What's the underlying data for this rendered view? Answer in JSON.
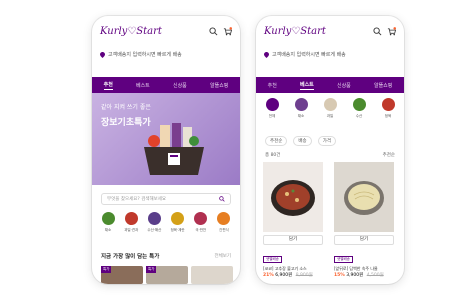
{
  "brand": {
    "logo": "Kurly♡Start",
    "accent": "#5f0080",
    "sale_color": "#fa622f"
  },
  "phone1": {
    "address": "고객배송지 입력하시면 빠르게 배송",
    "tabs": [
      "추천",
      "베스트",
      "신상품",
      "알뜰쇼핑"
    ],
    "active_tab": 0,
    "banner": {
      "subtitle": "같아 지켜 쓰기 좋은",
      "title": "장보기초특가"
    },
    "search_placeholder": "무엇을 찾으세요? 검색해보세요",
    "categories": [
      {
        "label": "채소",
        "color": "#4b8b2e"
      },
      {
        "label": "과일·견과",
        "color": "#c0392b"
      },
      {
        "label": "수산·해산",
        "color": "#5a3e8a"
      },
      {
        "label": "정육·계란",
        "color": "#d4a017"
      },
      {
        "label": "국·반찬",
        "color": "#b03050"
      },
      {
        "label": "간편식",
        "color": "#e67e22"
      }
    ],
    "section": {
      "title": "지금 가장 많이 담는 특가",
      "more": "전체보기"
    },
    "thumbs": [
      {
        "tag": "특가",
        "color": "#8a6d5a"
      },
      {
        "tag": "특가",
        "color": "#b5a99b"
      },
      {
        "tag": "",
        "color": "#ddd6cc"
      }
    ]
  },
  "phone2": {
    "address": "고객배송지 입력하시면 빠르게 배송",
    "tabs": [
      "추천",
      "베스트",
      "신상품",
      "알뜰쇼핑"
    ],
    "active_tab": 1,
    "categories": [
      {
        "label": "전체",
        "color": "#5f0080"
      },
      {
        "label": "채소",
        "color": "#6e3f8f"
      },
      {
        "label": "과일",
        "color": "#d7c9b2"
      },
      {
        "label": "수산",
        "color": "#4b8b2e"
      },
      {
        "label": "정육",
        "color": "#c0392b"
      }
    ],
    "filters": [
      "추천순",
      "배송",
      "가격"
    ],
    "count": "총 80건",
    "sort": "추천순",
    "products": [
      {
        "cart": "담기",
        "badge": "샛별배송",
        "name": "[코코] 고추장 불고기 소스",
        "discount": "21%",
        "price": "6,900원",
        "original": "8,900원",
        "img": "#3a2a22",
        "food": "#a0402a"
      },
      {
        "cart": "담기",
        "badge": "샛별배송",
        "name": "[앞뒤로] 담백한 숙주 나물",
        "discount": "15%",
        "price": "3,900원",
        "original": "4,500원",
        "img": "#c9c2b8",
        "food": "#e9dfb0"
      }
    ]
  }
}
